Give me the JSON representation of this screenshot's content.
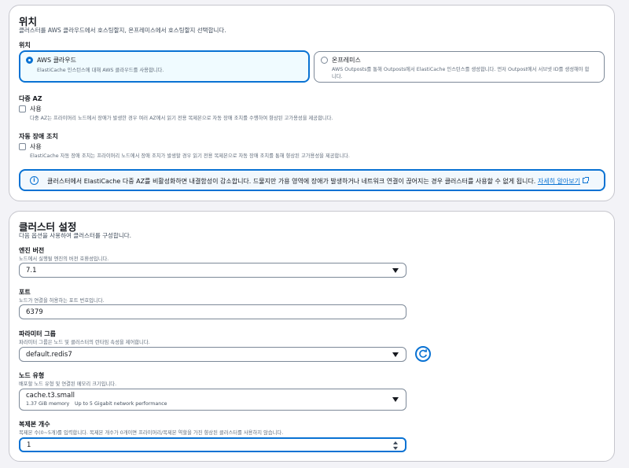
{
  "location": {
    "title": "위치",
    "description": "클러스터를 AWS 클라우드에서 호스팅할지, 온프레미스에서 호스팅할지 선택합니다.",
    "label": "위치",
    "options": [
      {
        "title": "AWS 클라우드",
        "description": "ElastiCache 인스턴스에 대해 AWS 클라우드를 사용합니다.",
        "selected": true
      },
      {
        "title": "온프레미스",
        "description": "AWS Outposts를 통해 Outposts에서 ElastiCache 인스턴스를 생성합니다. 먼저 Outpost에서 서브넷 ID를 생성해야 합",
        "description2": "니다.",
        "selected": false
      }
    ],
    "multi_az": {
      "title": "다중 AZ",
      "checkbox_label": "사용",
      "description": "다중 AZ는 프라이머리 노드에서 장애가 발생한 경우 여러 AZ에서 읽기 전용 복제본으로 자동 장애 조치를 수행하여 향상된 고가용성을 제공합니다."
    },
    "auto_failover": {
      "title": "자동 장애 조치",
      "checkbox_label": "사용",
      "description": "ElastiCache 자동 장애 조치는 프라이머리 노드에서 장애 조치가 발생할 경우 읽기 전용 복제본으로 자동 장애 조치를 통해 향상된 고가용성을 제공합니다."
    },
    "info": {
      "text": "클러스터에서 ElastiCache 다중 AZ를 비활성화하면 내결함성이 감소합니다. 드물지만 가용 영역에 장애가 발생하거나 네트워크 연결이 끊어지는 경우 클러스터를 사용할 수 없게 됩니다.",
      "link": "자세히 알아보기"
    }
  },
  "cluster": {
    "title": "클러스터 설정",
    "description": "다음 옵션을 사용하여 클러스터를 구성합니다.",
    "engine_version": {
      "label": "엔진 버전",
      "description": "노드에서 실행될 엔진의 버전 호환성입니다.",
      "value": "7.1"
    },
    "port": {
      "label": "포트",
      "description": "노드가 연결을 허용하는 포트 번호입니다.",
      "value": "6379"
    },
    "parameter_group": {
      "label": "파라미터 그룹",
      "description": "파라미터 그룹은 노드 및 클러스터의 런타임 속성을 제어합니다.",
      "value": "default.redis7"
    },
    "node_type": {
      "label": "노드 유형",
      "description": "배포할 노드 유형 및 연결된 메모리 크기입니다.",
      "value": "cache.t3.small",
      "memory": "1.37 GiB memory",
      "network": "Up to 5 Gigabit network performance"
    },
    "replicas": {
      "label": "복제본 개수",
      "description": "복제본 수(0~5개)를 입력합니다. 복제본 개수가 0개이면 프라이머리/복제본 역할을 가진 향상된 클러스터를 사용하지 않습니다.",
      "value": "1"
    }
  },
  "colors": {
    "accent": "#0972d3",
    "border": "#7d8998",
    "background": "#f3f3f7"
  }
}
